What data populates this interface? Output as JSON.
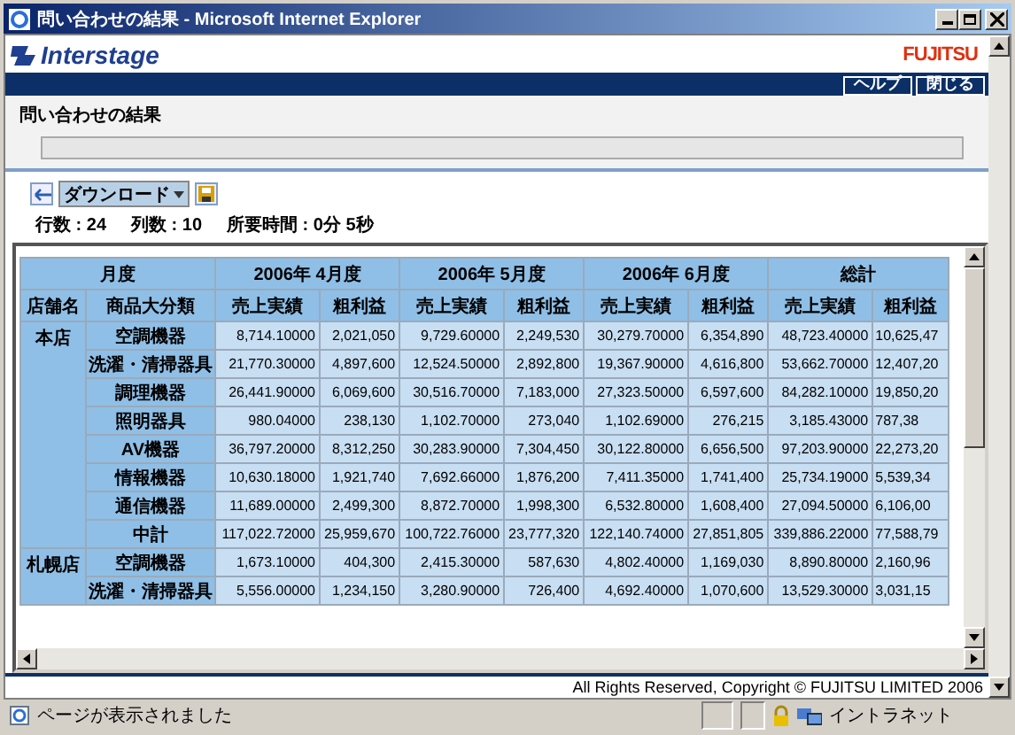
{
  "window": {
    "title": "問い合わせの結果 - Microsoft Internet Explorer"
  },
  "header": {
    "logo": "Interstage",
    "brand": "FUJITSU"
  },
  "nav_buttons": [
    "ヘルプ",
    "閉じる"
  ],
  "page_title": "問い合わせの結果",
  "toolbar": {
    "dropdown": "ダウンロード"
  },
  "stats": [
    "行数 : 24",
    "列数 : 10",
    "所要時間 : 0分 5秒"
  ],
  "table": {
    "corner": "月度",
    "groups": [
      "2006年 4月度",
      "2006年 5月度",
      "2006年 6月度",
      "総計"
    ],
    "columns": [
      "店舗名",
      "商品大分類",
      "売上実績",
      "粗利益",
      "売上実績",
      "粗利益",
      "売上実績",
      "粗利益",
      "売上実績",
      "粗利益"
    ],
    "rows": [
      {
        "store": "本店",
        "items": [
          {
            "category": "空調機器",
            "values": [
              "8,714.10000",
              "2,021,050",
              "9,729.60000",
              "2,249,530",
              "30,279.70000",
              "6,354,890",
              "48,723.40000",
              "10,625,47"
            ]
          },
          {
            "category": "洗濯・清掃器具",
            "values": [
              "21,770.30000",
              "4,897,600",
              "12,524.50000",
              "2,892,800",
              "19,367.90000",
              "4,616,800",
              "53,662.70000",
              "12,407,20"
            ]
          },
          {
            "category": "調理機器",
            "values": [
              "26,441.90000",
              "6,069,600",
              "30,516.70000",
              "7,183,000",
              "27,323.50000",
              "6,597,600",
              "84,282.10000",
              "19,850,20"
            ]
          },
          {
            "category": "照明器具",
            "values": [
              "980.04000",
              "238,130",
              "1,102.70000",
              "273,040",
              "1,102.69000",
              "276,215",
              "3,185.43000",
              "787,38"
            ]
          },
          {
            "category": "AV機器",
            "values": [
              "36,797.20000",
              "8,312,250",
              "30,283.90000",
              "7,304,450",
              "30,122.80000",
              "6,656,500",
              "97,203.90000",
              "22,273,20"
            ]
          },
          {
            "category": "情報機器",
            "values": [
              "10,630.18000",
              "1,921,740",
              "7,692.66000",
              "1,876,200",
              "7,411.35000",
              "1,741,400",
              "25,734.19000",
              "5,539,34"
            ]
          },
          {
            "category": "通信機器",
            "values": [
              "11,689.00000",
              "2,499,300",
              "8,872.70000",
              "1,998,300",
              "6,532.80000",
              "1,608,400",
              "27,094.50000",
              "6,106,00"
            ]
          },
          {
            "category": "中計",
            "values": [
              "117,022.72000",
              "25,959,670",
              "100,722.76000",
              "23,777,320",
              "122,140.74000",
              "27,851,805",
              "339,886.22000",
              "77,588,79"
            ]
          }
        ]
      },
      {
        "store": "札幌店",
        "items": [
          {
            "category": "空調機器",
            "values": [
              "1,673.10000",
              "404,300",
              "2,415.30000",
              "587,630",
              "4,802.40000",
              "1,169,030",
              "8,890.80000",
              "2,160,96"
            ]
          },
          {
            "category": "洗濯・清掃器具",
            "values": [
              "5,556.00000",
              "1,234,150",
              "3,280.90000",
              "726,400",
              "4,692.40000",
              "1,070,600",
              "13,529.30000",
              "3,031,15"
            ]
          }
        ]
      }
    ]
  },
  "footer": "All Rights Reserved, Copyright © FUJITSU LIMITED 2006",
  "status_bar": {
    "text": "ページが表示されました",
    "zone": "イントラネット"
  }
}
